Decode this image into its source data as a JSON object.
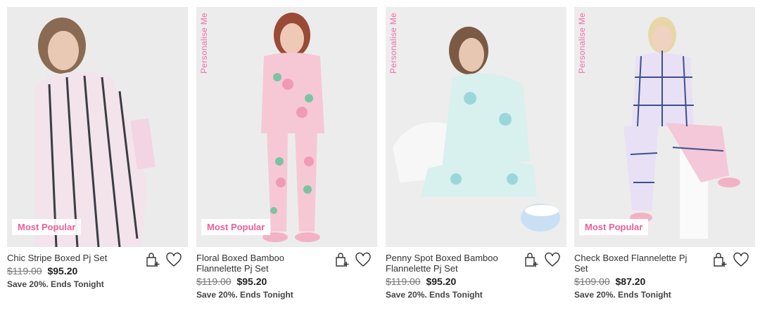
{
  "products": [
    {
      "name": "Chic Stripe Boxed Pj Set",
      "was_price": "$119.00",
      "now_price": "$95.20",
      "promo": "Save 20%. Ends Tonight",
      "badge": "Most Popular",
      "tag": "",
      "bg_color": "#ebebeb",
      "garment_color": "#f2e4ea",
      "accent_color": "#3c3c44"
    },
    {
      "name": "Floral Boxed Bamboo Flannelette Pj Set",
      "was_price": "$119.00",
      "now_price": "$95.20",
      "promo": "Save 20%. Ends Tonight",
      "badge": "Most Popular",
      "tag": "Personalise Me",
      "bg_color": "#ececec",
      "garment_color": "#f6c8d6",
      "accent_color": "#7cc3a2"
    },
    {
      "name": "Penny Spot Boxed Bamboo Flannelette Pj Set",
      "was_price": "$119.00",
      "now_price": "$95.20",
      "promo": "Save 20%. Ends Tonight",
      "badge": "",
      "tag": "Personalise Me",
      "bg_color": "#ededed",
      "garment_color": "#d8f0ee",
      "accent_color": "#9ad7db"
    },
    {
      "name": "Check Boxed Flannelette Pj Set",
      "was_price": "$109.00",
      "now_price": "$87.20",
      "promo": "Save 20%. Ends Tonight",
      "badge": "Most Popular",
      "tag": "Personalise Me",
      "bg_color": "#ececec",
      "garment_color": "#e8e0f4",
      "accent_color": "#3d4f8f"
    }
  ],
  "icons": {
    "add_to_bag": "bag-plus-icon",
    "wishlist": "heart-icon"
  },
  "colors": {
    "brand_pink": "#ec5f9c",
    "text": "#222222",
    "strike": "#777777"
  }
}
